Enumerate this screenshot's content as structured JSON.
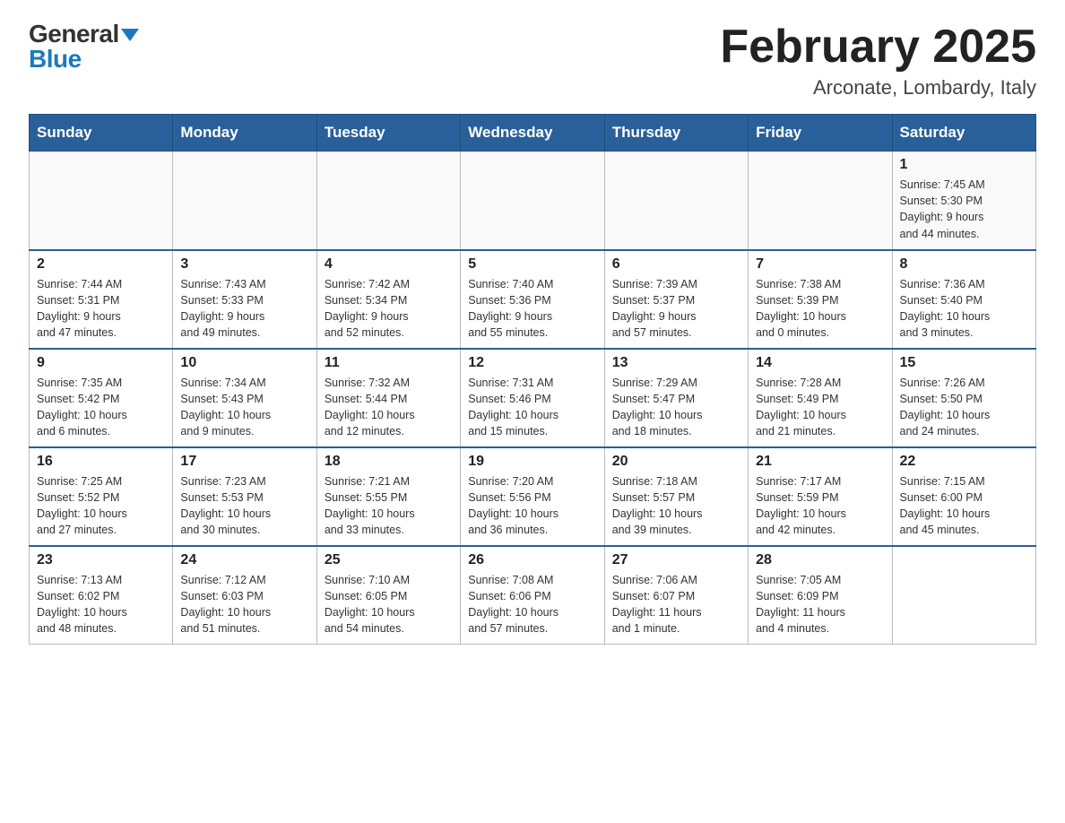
{
  "header": {
    "logo": {
      "general": "General",
      "blue": "Blue",
      "triangle": true
    },
    "title": "February 2025",
    "location": "Arconate, Lombardy, Italy"
  },
  "weekdays": [
    "Sunday",
    "Monday",
    "Tuesday",
    "Wednesday",
    "Thursday",
    "Friday",
    "Saturday"
  ],
  "weeks": [
    {
      "days": [
        {
          "num": "",
          "info": ""
        },
        {
          "num": "",
          "info": ""
        },
        {
          "num": "",
          "info": ""
        },
        {
          "num": "",
          "info": ""
        },
        {
          "num": "",
          "info": ""
        },
        {
          "num": "",
          "info": ""
        },
        {
          "num": "1",
          "info": "Sunrise: 7:45 AM\nSunset: 5:30 PM\nDaylight: 9 hours\nand 44 minutes."
        }
      ]
    },
    {
      "days": [
        {
          "num": "2",
          "info": "Sunrise: 7:44 AM\nSunset: 5:31 PM\nDaylight: 9 hours\nand 47 minutes."
        },
        {
          "num": "3",
          "info": "Sunrise: 7:43 AM\nSunset: 5:33 PM\nDaylight: 9 hours\nand 49 minutes."
        },
        {
          "num": "4",
          "info": "Sunrise: 7:42 AM\nSunset: 5:34 PM\nDaylight: 9 hours\nand 52 minutes."
        },
        {
          "num": "5",
          "info": "Sunrise: 7:40 AM\nSunset: 5:36 PM\nDaylight: 9 hours\nand 55 minutes."
        },
        {
          "num": "6",
          "info": "Sunrise: 7:39 AM\nSunset: 5:37 PM\nDaylight: 9 hours\nand 57 minutes."
        },
        {
          "num": "7",
          "info": "Sunrise: 7:38 AM\nSunset: 5:39 PM\nDaylight: 10 hours\nand 0 minutes."
        },
        {
          "num": "8",
          "info": "Sunrise: 7:36 AM\nSunset: 5:40 PM\nDaylight: 10 hours\nand 3 minutes."
        }
      ]
    },
    {
      "days": [
        {
          "num": "9",
          "info": "Sunrise: 7:35 AM\nSunset: 5:42 PM\nDaylight: 10 hours\nand 6 minutes."
        },
        {
          "num": "10",
          "info": "Sunrise: 7:34 AM\nSunset: 5:43 PM\nDaylight: 10 hours\nand 9 minutes."
        },
        {
          "num": "11",
          "info": "Sunrise: 7:32 AM\nSunset: 5:44 PM\nDaylight: 10 hours\nand 12 minutes."
        },
        {
          "num": "12",
          "info": "Sunrise: 7:31 AM\nSunset: 5:46 PM\nDaylight: 10 hours\nand 15 minutes."
        },
        {
          "num": "13",
          "info": "Sunrise: 7:29 AM\nSunset: 5:47 PM\nDaylight: 10 hours\nand 18 minutes."
        },
        {
          "num": "14",
          "info": "Sunrise: 7:28 AM\nSunset: 5:49 PM\nDaylight: 10 hours\nand 21 minutes."
        },
        {
          "num": "15",
          "info": "Sunrise: 7:26 AM\nSunset: 5:50 PM\nDaylight: 10 hours\nand 24 minutes."
        }
      ]
    },
    {
      "days": [
        {
          "num": "16",
          "info": "Sunrise: 7:25 AM\nSunset: 5:52 PM\nDaylight: 10 hours\nand 27 minutes."
        },
        {
          "num": "17",
          "info": "Sunrise: 7:23 AM\nSunset: 5:53 PM\nDaylight: 10 hours\nand 30 minutes."
        },
        {
          "num": "18",
          "info": "Sunrise: 7:21 AM\nSunset: 5:55 PM\nDaylight: 10 hours\nand 33 minutes."
        },
        {
          "num": "19",
          "info": "Sunrise: 7:20 AM\nSunset: 5:56 PM\nDaylight: 10 hours\nand 36 minutes."
        },
        {
          "num": "20",
          "info": "Sunrise: 7:18 AM\nSunset: 5:57 PM\nDaylight: 10 hours\nand 39 minutes."
        },
        {
          "num": "21",
          "info": "Sunrise: 7:17 AM\nSunset: 5:59 PM\nDaylight: 10 hours\nand 42 minutes."
        },
        {
          "num": "22",
          "info": "Sunrise: 7:15 AM\nSunset: 6:00 PM\nDaylight: 10 hours\nand 45 minutes."
        }
      ]
    },
    {
      "days": [
        {
          "num": "23",
          "info": "Sunrise: 7:13 AM\nSunset: 6:02 PM\nDaylight: 10 hours\nand 48 minutes."
        },
        {
          "num": "24",
          "info": "Sunrise: 7:12 AM\nSunset: 6:03 PM\nDaylight: 10 hours\nand 51 minutes."
        },
        {
          "num": "25",
          "info": "Sunrise: 7:10 AM\nSunset: 6:05 PM\nDaylight: 10 hours\nand 54 minutes."
        },
        {
          "num": "26",
          "info": "Sunrise: 7:08 AM\nSunset: 6:06 PM\nDaylight: 10 hours\nand 57 minutes."
        },
        {
          "num": "27",
          "info": "Sunrise: 7:06 AM\nSunset: 6:07 PM\nDaylight: 11 hours\nand 1 minute."
        },
        {
          "num": "28",
          "info": "Sunrise: 7:05 AM\nSunset: 6:09 PM\nDaylight: 11 hours\nand 4 minutes."
        },
        {
          "num": "",
          "info": ""
        }
      ]
    }
  ]
}
